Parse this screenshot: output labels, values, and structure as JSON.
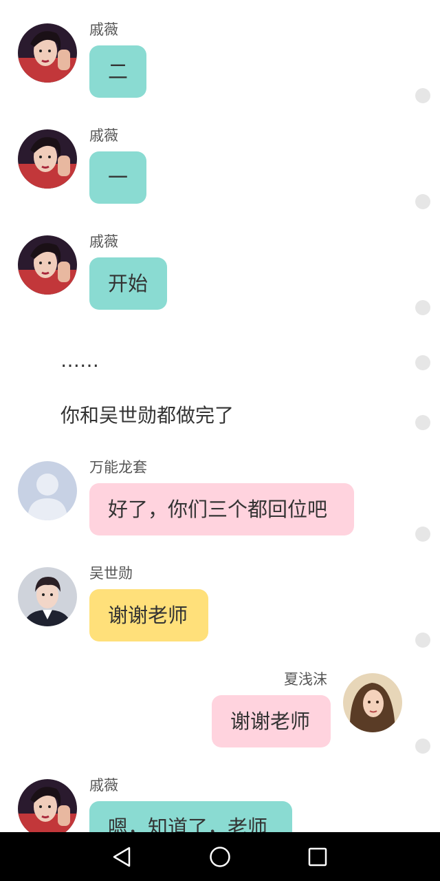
{
  "messages": [
    {
      "sender": "戚薇",
      "text": "二",
      "side": "left",
      "bubble_color": "#8adbd2",
      "avatar": "qiwei-avatar"
    },
    {
      "sender": "戚薇",
      "text": "一",
      "side": "left",
      "bubble_color": "#8adbd2",
      "avatar": "qiwei-avatar"
    },
    {
      "sender": "戚薇",
      "text": "开始",
      "side": "left",
      "bubble_color": "#8adbd2",
      "avatar": "qiwei-avatar"
    },
    {
      "narration": "……"
    },
    {
      "narration": "你和吴世勋都做完了"
    },
    {
      "sender": "万能龙套",
      "text": "好了，你们三个都回位吧",
      "side": "left",
      "bubble_color": "#ffd3de",
      "avatar": "default-user-avatar"
    },
    {
      "sender": "吴世勋",
      "text": "谢谢老师",
      "side": "left",
      "bubble_color": "#ffe07a",
      "avatar": "wushixun-avatar"
    },
    {
      "sender": "夏浅沫",
      "text": "谢谢老师",
      "side": "right",
      "bubble_color": "#ffd3de",
      "avatar": "xiaqianmo-avatar"
    },
    {
      "sender": "戚薇",
      "text": "嗯，知道了，老师",
      "side": "left",
      "bubble_color": "#8adbd2",
      "avatar": "qiwei-avatar"
    }
  ],
  "navbar": {
    "back": "back-triangle-icon",
    "home": "home-circle-icon",
    "recents": "recents-square-icon"
  },
  "colors": {
    "teal_bubble": "#8adbd2",
    "pink_bubble": "#ffd3de",
    "yellow_bubble": "#ffe07a",
    "navbar_bg": "#000000"
  }
}
